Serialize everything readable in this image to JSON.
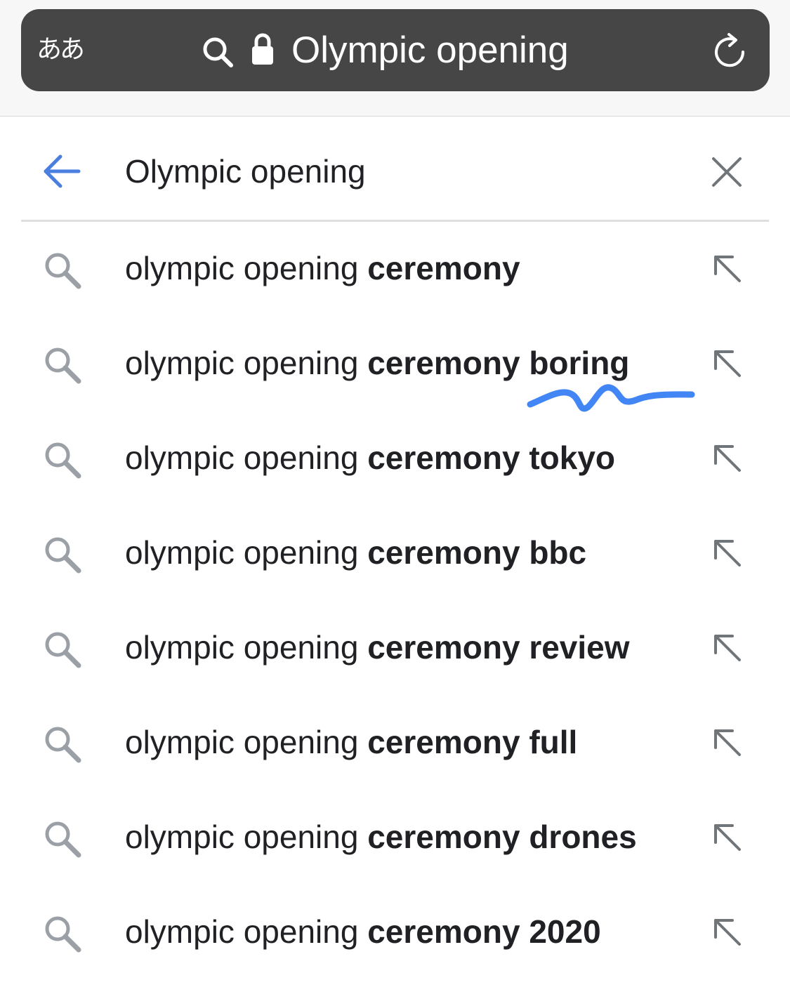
{
  "browser": {
    "aa_label": "ああ",
    "url_text": "Olympic opening"
  },
  "search": {
    "query": "Olympic opening"
  },
  "suggestions": [
    {
      "prefix": "olympic opening ",
      "completion": "ceremony"
    },
    {
      "prefix": "olympic opening ",
      "completion": "ceremony boring"
    },
    {
      "prefix": "olympic opening ",
      "completion": "ceremony tokyo"
    },
    {
      "prefix": "olympic opening ",
      "completion": "ceremony bbc"
    },
    {
      "prefix": "olympic opening ",
      "completion": "ceremony review"
    },
    {
      "prefix": "olympic opening ",
      "completion": "ceremony full"
    },
    {
      "prefix": "olympic opening ",
      "completion": "ceremony drones"
    },
    {
      "prefix": "olympic opening ",
      "completion": "ceremony 2020"
    }
  ],
  "icons": {
    "url_search": "search-icon",
    "lock": "lock-icon",
    "reload": "reload-icon",
    "back": "arrow-left-icon",
    "clear": "close-icon",
    "suggestion": "search-icon",
    "fill": "arrow-up-left-icon"
  },
  "colors": {
    "url_bar": "#464646",
    "accent_blue": "#4a7fe0",
    "scribble": "#4285f4",
    "icon_gray": "#9aa0a6",
    "text": "#202124"
  }
}
